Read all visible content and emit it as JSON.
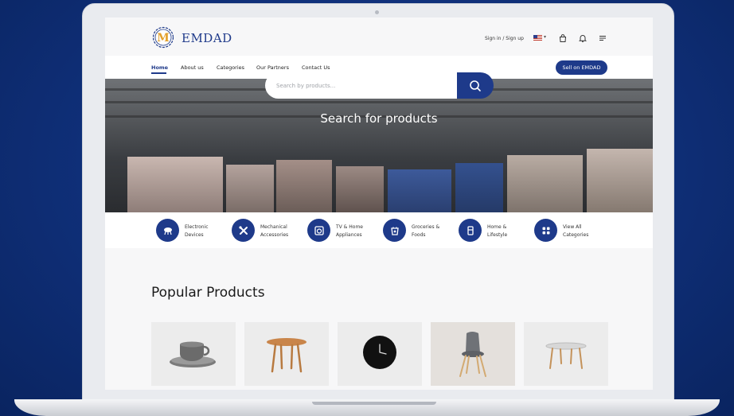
{
  "brand": {
    "name": "EMDAD",
    "logo_letter": "M"
  },
  "header": {
    "sign_link": "Sign in / Sign up",
    "icons": [
      "us-flag-icon",
      "chevron-down-icon",
      "shopping-bag-icon",
      "bell-icon",
      "menu-icon"
    ]
  },
  "nav": {
    "items": [
      {
        "label": "Home",
        "active": true
      },
      {
        "label": "About us"
      },
      {
        "label": "Categories"
      },
      {
        "label": "Our Partners"
      },
      {
        "label": "Contact Us"
      }
    ],
    "sell_button": "Sell on EMDAD"
  },
  "hero": {
    "title": "Search for products",
    "search_placeholder": "Search by products...",
    "search_icon": "search-icon"
  },
  "categories": [
    {
      "label": "Electronic Devices",
      "icon": "drone-icon"
    },
    {
      "label": "Mechanical Accessories",
      "icon": "tools-icon"
    },
    {
      "label": "TV & Home Appliances",
      "icon": "appliance-icon"
    },
    {
      "label": "Groceries & Foods",
      "icon": "grocery-icon"
    },
    {
      "label": "Home & Lifestyle",
      "icon": "furniture-icon"
    },
    {
      "label": "View All Categories",
      "icon": "grid-icon"
    }
  ],
  "popular": {
    "title": "Popular Products",
    "products": [
      {
        "image": "coffee-cup"
      },
      {
        "image": "wooden-table"
      },
      {
        "image": "wall-clock"
      },
      {
        "image": "grey-chair"
      },
      {
        "image": "coffee-table"
      }
    ]
  },
  "colors": {
    "primary": "#1e3a8a",
    "logo_gold": "#e3a02b",
    "background": "#0f2f78"
  }
}
